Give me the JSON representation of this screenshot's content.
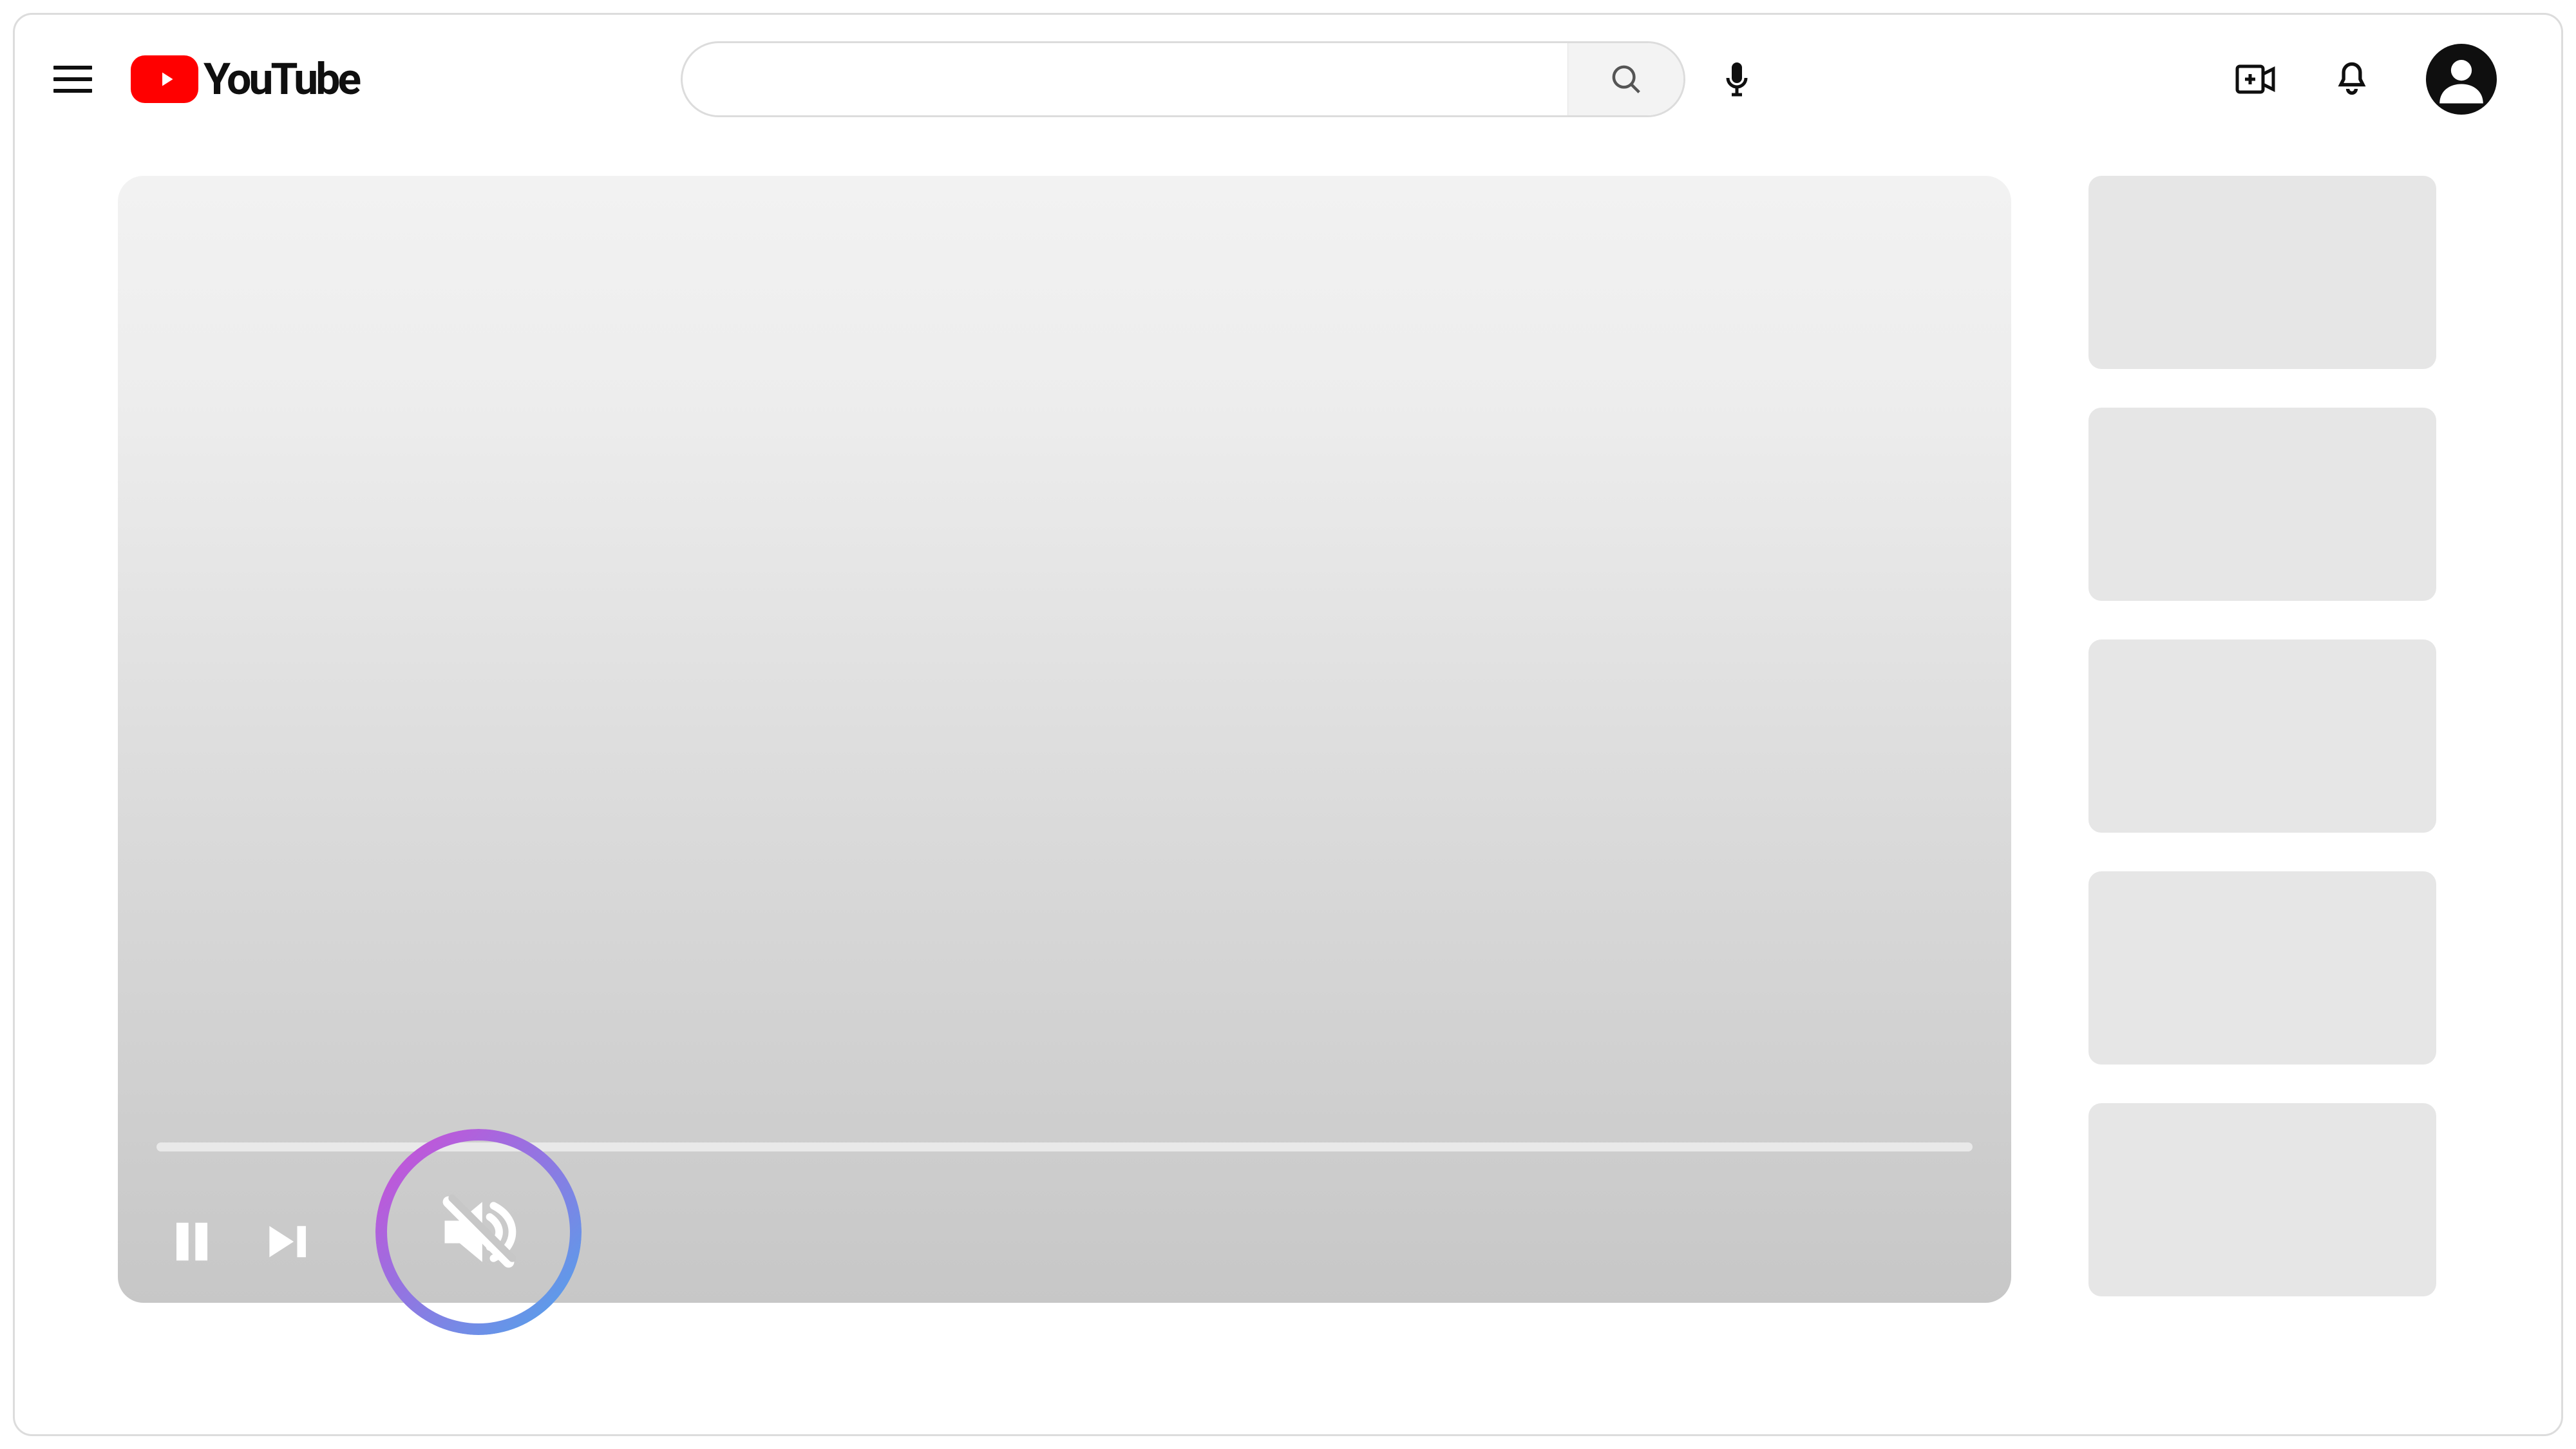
{
  "brand": {
    "name": "YouTube"
  },
  "search": {
    "value": "",
    "placeholder": ""
  },
  "player": {
    "state": "playing",
    "muted": true,
    "highlighted_control": "mute"
  },
  "sidebar": {
    "recommendation_count": 5
  },
  "colors": {
    "brand_red": "#ff0000",
    "placeholder_grey": "#e6e6e6",
    "highlight_gradient_start": "#d24bd6",
    "highlight_gradient_end": "#4ca7ec"
  }
}
